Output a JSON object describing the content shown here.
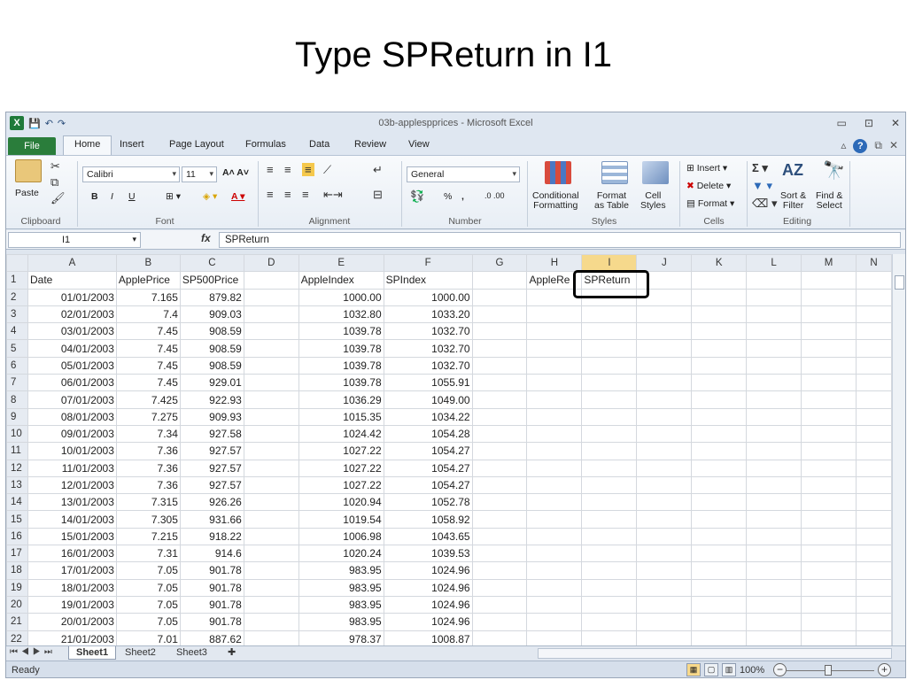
{
  "slide_title": "Type SPReturn in I1",
  "window": {
    "title": "03b-applespprices - Microsoft Excel",
    "controls": [
      "▭",
      "⊡",
      "✕"
    ]
  },
  "ribbon_tabs": [
    "File",
    "Home",
    "Insert",
    "Page Layout",
    "Formulas",
    "Data",
    "Review",
    "View"
  ],
  "ribbon": {
    "clipboard": {
      "label": "Clipboard",
      "paste": "Paste"
    },
    "font": {
      "label": "Font",
      "name": "Calibri",
      "size": "11",
      "bold": "B",
      "italic": "I",
      "underline": "U"
    },
    "alignment": {
      "label": "Alignment"
    },
    "number": {
      "label": "Number",
      "format": "General",
      "percent": "%",
      "comma": ","
    },
    "styles": {
      "label": "Styles",
      "conditional": "Conditional\nFormatting",
      "format_table": "Format\nas Table",
      "cell_styles": "Cell\nStyles"
    },
    "cells": {
      "label": "Cells",
      "insert": "Insert",
      "delete": "Delete",
      "format": "Format"
    },
    "editing": {
      "label": "Editing",
      "sort": "Sort &\nFilter",
      "find": "Find &\nSelect"
    }
  },
  "formula_bar": {
    "name_box": "I1",
    "content": "SPReturn"
  },
  "columns": [
    "A",
    "B",
    "C",
    "D",
    "E",
    "F",
    "G",
    "H",
    "I",
    "J",
    "K",
    "L",
    "M",
    "N"
  ],
  "header_row": [
    "Date",
    "ApplePrice",
    "SP500Price",
    "",
    "AppleIndex",
    "SPIndex",
    "",
    "AppleRe",
    "SPReturn"
  ],
  "rows": [
    [
      "01/01/2003",
      "7.165",
      "879.82",
      "",
      "1000.00",
      "1000.00"
    ],
    [
      "02/01/2003",
      "7.4",
      "909.03",
      "",
      "1032.80",
      "1033.20"
    ],
    [
      "03/01/2003",
      "7.45",
      "908.59",
      "",
      "1039.78",
      "1032.70"
    ],
    [
      "04/01/2003",
      "7.45",
      "908.59",
      "",
      "1039.78",
      "1032.70"
    ],
    [
      "05/01/2003",
      "7.45",
      "908.59",
      "",
      "1039.78",
      "1032.70"
    ],
    [
      "06/01/2003",
      "7.45",
      "929.01",
      "",
      "1039.78",
      "1055.91"
    ],
    [
      "07/01/2003",
      "7.425",
      "922.93",
      "",
      "1036.29",
      "1049.00"
    ],
    [
      "08/01/2003",
      "7.275",
      "909.93",
      "",
      "1015.35",
      "1034.22"
    ],
    [
      "09/01/2003",
      "7.34",
      "927.58",
      "",
      "1024.42",
      "1054.28"
    ],
    [
      "10/01/2003",
      "7.36",
      "927.57",
      "",
      "1027.22",
      "1054.27"
    ],
    [
      "11/01/2003",
      "7.36",
      "927.57",
      "",
      "1027.22",
      "1054.27"
    ],
    [
      "12/01/2003",
      "7.36",
      "927.57",
      "",
      "1027.22",
      "1054.27"
    ],
    [
      "13/01/2003",
      "7.315",
      "926.26",
      "",
      "1020.94",
      "1052.78"
    ],
    [
      "14/01/2003",
      "7.305",
      "931.66",
      "",
      "1019.54",
      "1058.92"
    ],
    [
      "15/01/2003",
      "7.215",
      "918.22",
      "",
      "1006.98",
      "1043.65"
    ],
    [
      "16/01/2003",
      "7.31",
      "914.6",
      "",
      "1020.24",
      "1039.53"
    ],
    [
      "17/01/2003",
      "7.05",
      "901.78",
      "",
      "983.95",
      "1024.96"
    ],
    [
      "18/01/2003",
      "7.05",
      "901.78",
      "",
      "983.95",
      "1024.96"
    ],
    [
      "19/01/2003",
      "7.05",
      "901.78",
      "",
      "983.95",
      "1024.96"
    ],
    [
      "20/01/2003",
      "7.05",
      "901.78",
      "",
      "983.95",
      "1024.96"
    ],
    [
      "21/01/2003",
      "7.01",
      "887.62",
      "",
      "978.37",
      "1008.87"
    ]
  ],
  "sheet_tabs": [
    "Sheet1",
    "Sheet2",
    "Sheet3"
  ],
  "status": {
    "ready": "Ready",
    "zoom": "100%"
  }
}
